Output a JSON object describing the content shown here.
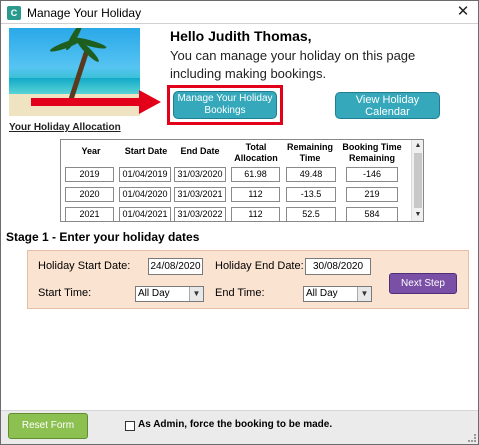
{
  "window": {
    "title": "Manage Your Holiday",
    "close_glyph": "✕",
    "app_icon_glyph": "C"
  },
  "greeting": {
    "hello": "Hello Judith Thomas,",
    "intro": "You can manage your holiday on this page including making bookings."
  },
  "buttons": {
    "manage_bookings": "Manage Your Holiday Bookings",
    "view_calendar": "View Holiday Calendar",
    "next_step": "Next Step",
    "reset_form": "Reset Form"
  },
  "allocation": {
    "label": "Your Holiday Allocation",
    "columns": [
      "Year",
      "Start Date",
      "End Date",
      "Total Allocation",
      "Remaining Time",
      "Booking Time Remaining"
    ],
    "rows": [
      [
        "2019",
        "01/04/2019",
        "31/03/2020",
        "61.98",
        "49.48",
        "-146"
      ],
      [
        "2020",
        "01/04/2020",
        "31/03/2021",
        "112",
        "-13.5",
        "219"
      ],
      [
        "2021",
        "01/04/2021",
        "31/03/2022",
        "112",
        "52.5",
        "584"
      ]
    ]
  },
  "stage1": {
    "title": "Stage 1 - Enter your holiday dates",
    "start_date_label": "Holiday Start Date:",
    "start_date_value": "24/08/2020",
    "end_date_label": "Holiday End Date:",
    "end_date_value": "30/08/2020",
    "start_time_label": "Start Time:",
    "start_time_value": "All Day",
    "end_time_label": "End Time:",
    "end_time_value": "All Day"
  },
  "admin": {
    "force_label": "As Admin, force the booking to be made."
  },
  "colors": {
    "accent_teal": "#35a8bc",
    "highlight_red": "#e3001b",
    "next_purple": "#7a50a6",
    "reset_green": "#8cc152",
    "panel_peach": "#fbe3d2"
  }
}
